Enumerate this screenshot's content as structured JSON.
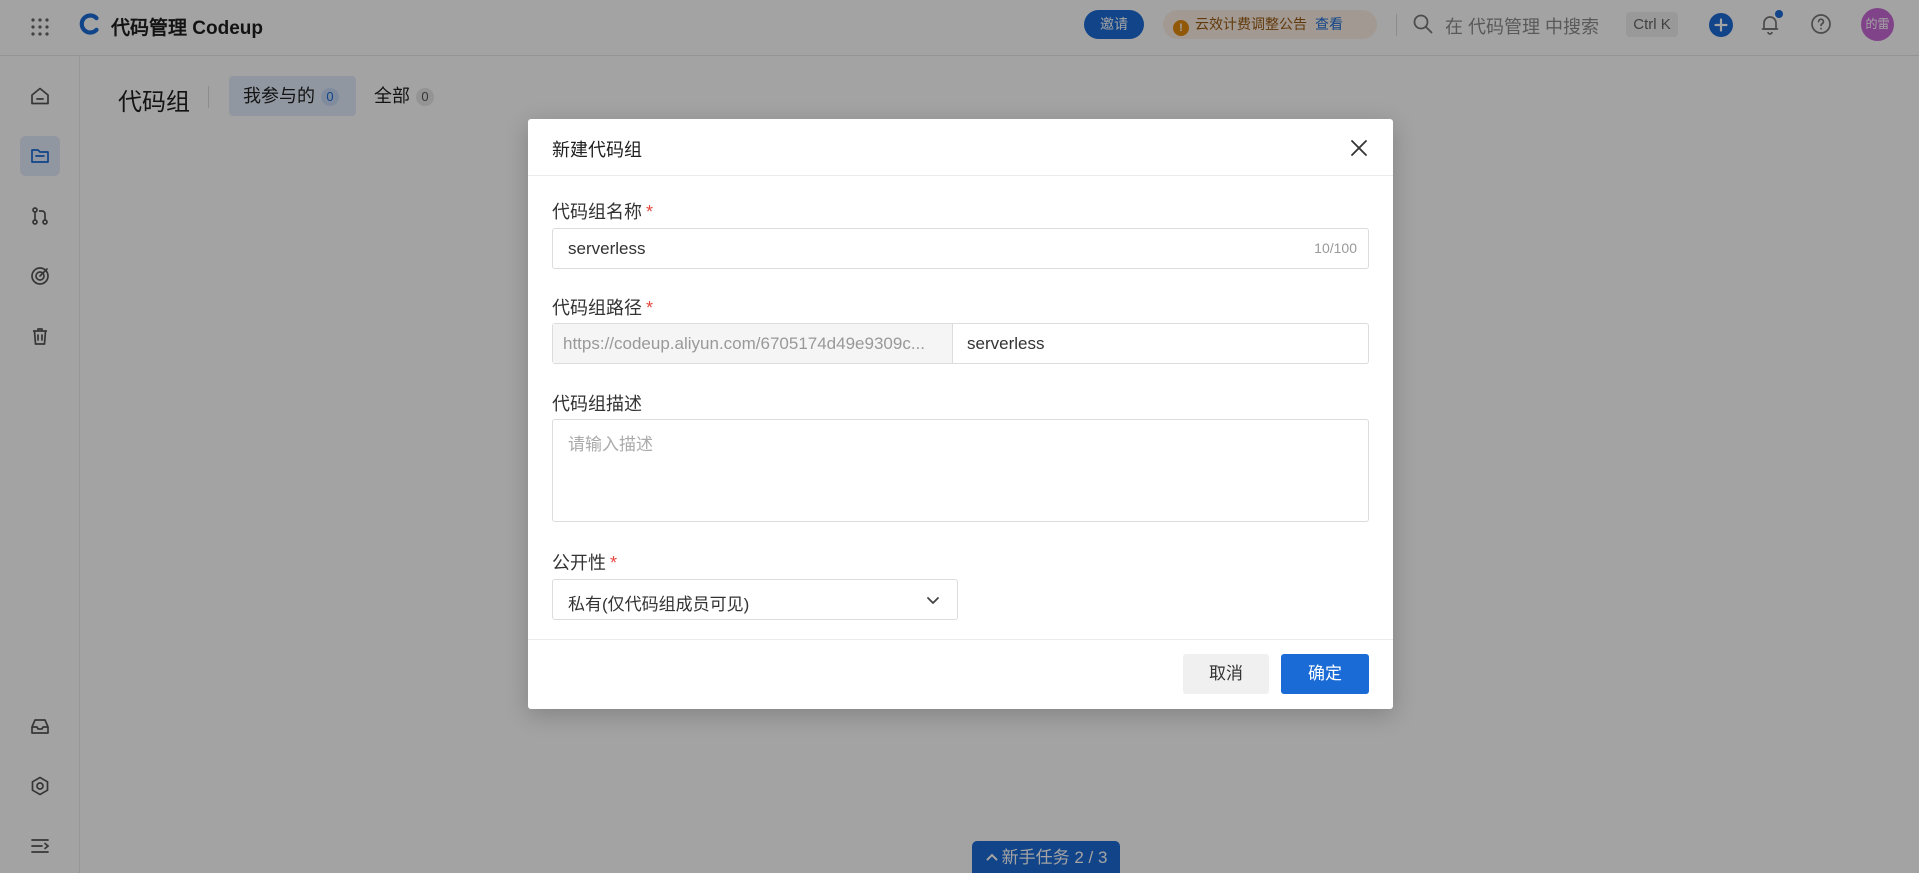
{
  "topbar": {
    "app_title": "代码管理 Codeup",
    "invite_label": "邀请",
    "notice_text": "云效计费调整公告",
    "notice_link": "查看",
    "search_placeholder": "在 代码管理 中搜索",
    "search_shortcut": "Ctrl K",
    "avatar_text": "的雷"
  },
  "main": {
    "page_title": "代码组",
    "tabs": [
      {
        "label": "我参与的",
        "count": "0",
        "active": true
      },
      {
        "label": "全部",
        "count": "0",
        "active": false
      }
    ],
    "task_pill": "新手任务 2 / 3"
  },
  "modal": {
    "title": "新建代码组",
    "name_label": "代码组名称",
    "name_value": "serverless",
    "name_counter": "10/100",
    "path_label": "代码组路径",
    "path_prefix": "https://codeup.aliyun.com/6705174d49e9309c...",
    "path_value": "serverless",
    "desc_label": "代码组描述",
    "desc_placeholder": "请输入描述",
    "visibility_label": "公开性",
    "visibility_value": "私有(仅代码组成员可见)",
    "required_mark": "*",
    "cancel_label": "取消",
    "ok_label": "确定"
  },
  "colors": {
    "primary": "#1b6bd6",
    "required": "#e5483f",
    "notice_bg": "#fdf1e4",
    "notice_icon": "#e38a0c",
    "avatar_bg": "#c86ad6"
  }
}
